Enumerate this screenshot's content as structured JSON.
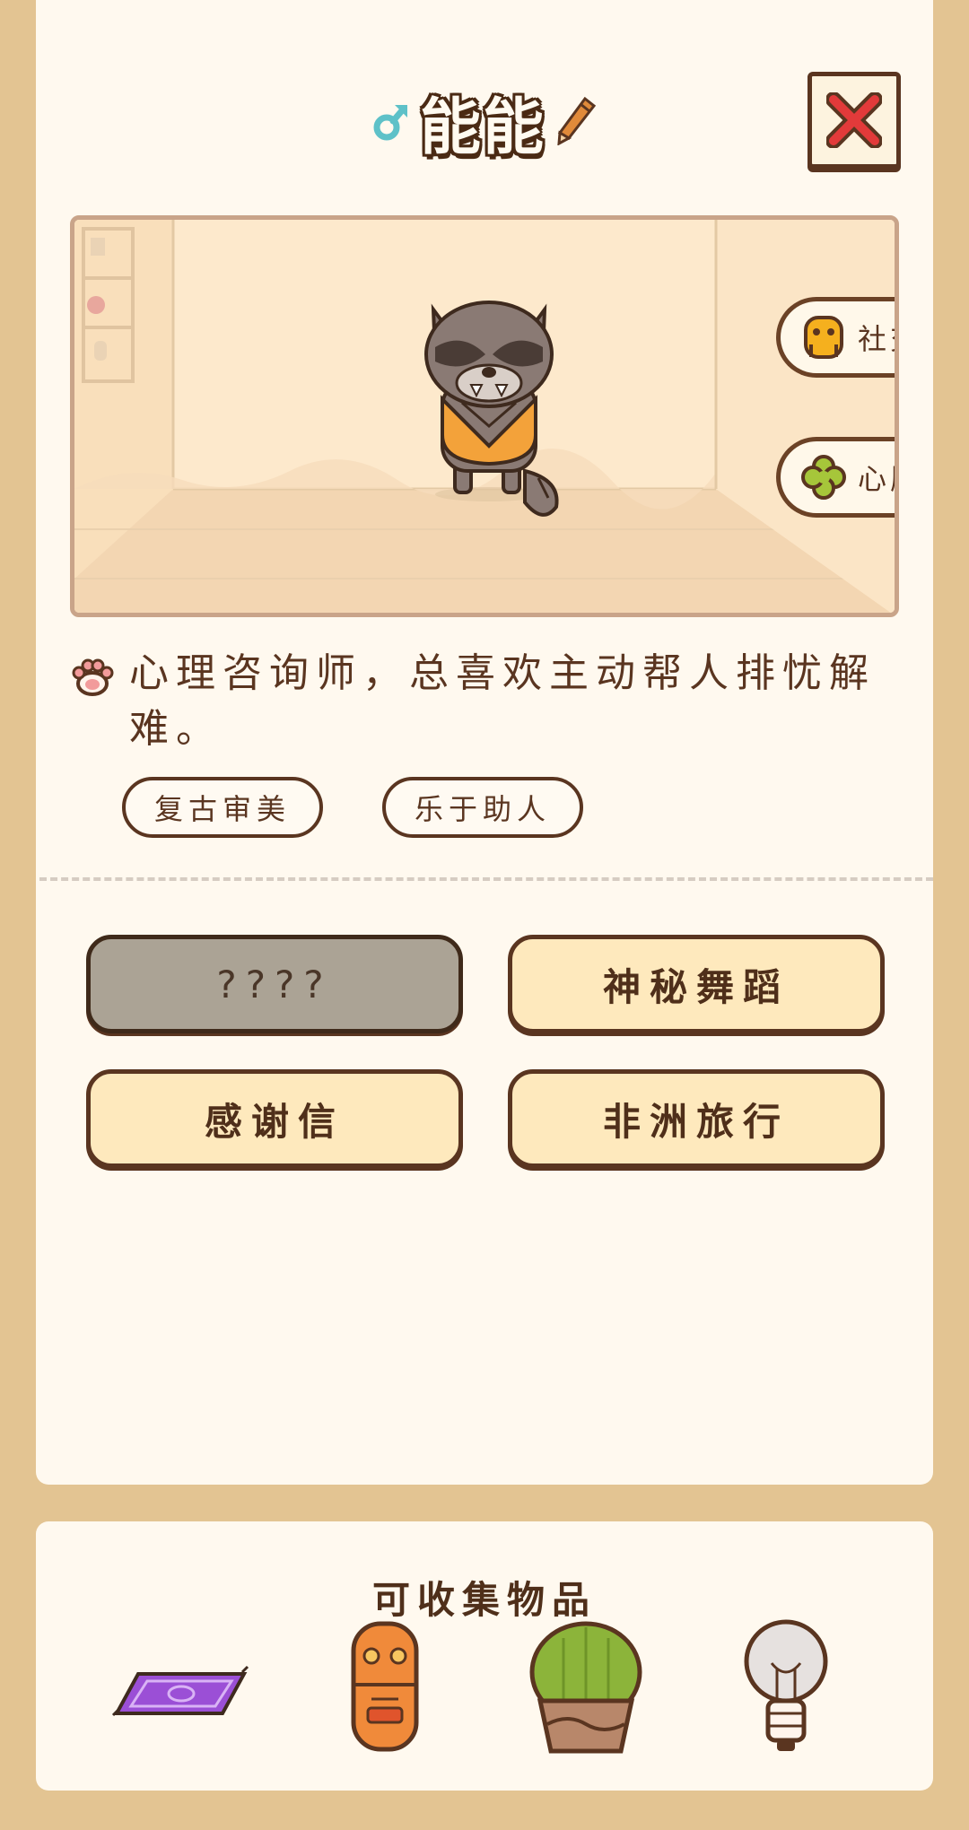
{
  "character": {
    "gender_icon": "male-symbol-icon",
    "name": "能能",
    "edit_icon": "pencil-icon",
    "close_icon": "close-x-icon"
  },
  "scene": {
    "buttons": [
      {
        "label": "社交",
        "icon": "social-figure-icon"
      },
      {
        "label": "心愿",
        "icon": "clover-wish-icon"
      }
    ]
  },
  "bio": {
    "icon": "paw-icon",
    "text": "心理咨询师，总喜欢主动帮人排忧解难。"
  },
  "tags": [
    "复古审美",
    "乐于助人"
  ],
  "actions": [
    {
      "label": "????",
      "locked": true
    },
    {
      "label": "神秘舞蹈",
      "locked": false
    },
    {
      "label": "感谢信",
      "locked": false
    },
    {
      "label": "非洲旅行",
      "locked": false
    }
  ],
  "collectibles": {
    "title": "可收集物品",
    "items": [
      "purple-rug-icon",
      "tiki-totem-icon",
      "potted-cactus-icon",
      "lightbulb-icon"
    ]
  },
  "colors": {
    "background": "#e3c492",
    "card": "#fff9ef",
    "outline": "#5a3520",
    "button_fill": "#fee9bd",
    "locked_fill": "#aba395",
    "gender_blue": "#5ec1c8"
  }
}
